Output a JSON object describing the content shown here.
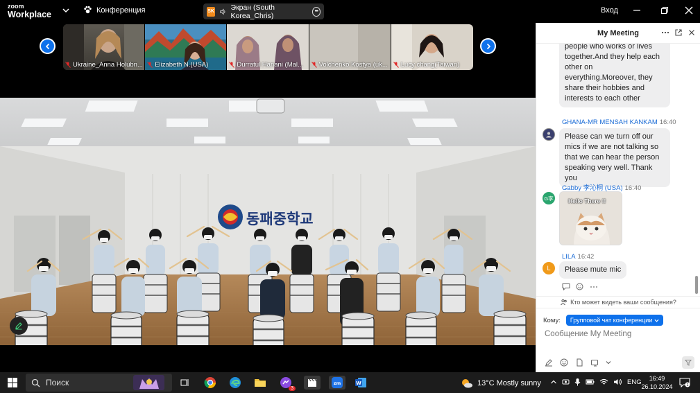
{
  "titlebar": {
    "brand_top": "zoom",
    "brand_bottom": "Workplace",
    "meeting_label": "Конференция",
    "share_badge": "SK",
    "share_label": "Экран (South Korea_Chris)",
    "signin": "Вход"
  },
  "participants": [
    {
      "name": "Ukraine_Anna Holubn..."
    },
    {
      "name": "Elizabeth N.(USA)"
    },
    {
      "name": "Durratul Hanani (Mal..."
    },
    {
      "name": "Volchenko Kostya (uk..."
    },
    {
      "name": "Lucy chang(Taiwan)"
    }
  ],
  "video": {
    "school_sign": "동패중학교"
  },
  "chat": {
    "title": "My Meeting",
    "messages": [
      {
        "sender": "",
        "time": "",
        "text_lines": [
          "people who works or lives",
          "together.And they help each",
          "other on",
          "everything.Moreover, they",
          "share their hobbies and",
          "interests  to each other"
        ]
      },
      {
        "sender": "GHANA-MR MENSAH KANKAM",
        "time": "16:40",
        "text_lines": [
          "Please can we turn off our",
          "mics if we are not talking so",
          "that we can hear the person",
          "speaking very well. Thank you"
        ]
      },
      {
        "sender": "Gabby 李沁桐 (USA)",
        "time": "16:40",
        "avatar": "G李",
        "sticker_text": "Hello There !!"
      },
      {
        "sender": "LILA",
        "time": "16:42",
        "avatar": "L",
        "text": "Please mute mic"
      }
    ],
    "who_sees": "Кто может видеть ваши сообщения?",
    "to_label": "Кому:",
    "to_value": "Групповой чат конференции",
    "composer_placeholder": "Сообщение My Meeting"
  },
  "taskbar": {
    "search": "Поиск",
    "chat_badge": "3",
    "weather": "13°C  Mostly sunny",
    "lang": "ENG",
    "time": "16:49",
    "date": "26.10.2024",
    "notif_count": "1"
  },
  "colors": {
    "accent": "#0e71eb",
    "sender": "#1a6bd6",
    "share_badge": "#f08a1c",
    "bubble": "#eeeeef"
  }
}
